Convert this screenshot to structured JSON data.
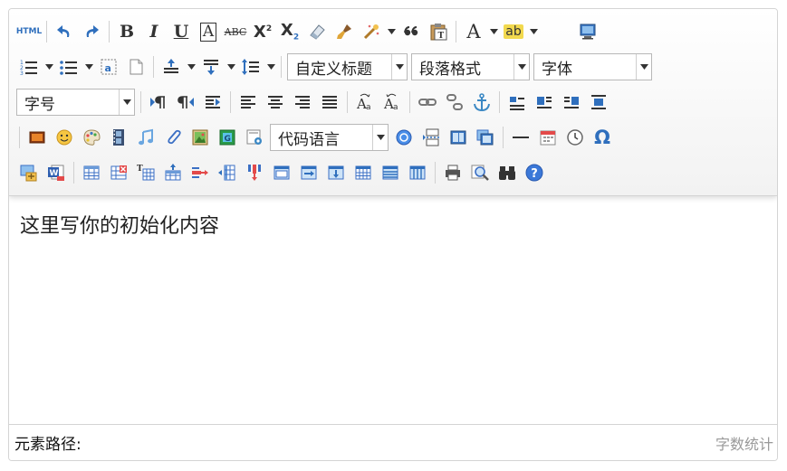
{
  "toolbar": {
    "source_label": "HTML",
    "bold": "B",
    "italic": "I",
    "underline": "U",
    "fontborder": "A",
    "strike": "ABC",
    "superscript_base": "X",
    "superscript_mark": "2",
    "subscript_base": "X",
    "subscript_mark": "2",
    "forecolor": "A",
    "backcolor": "ab",
    "custom_style": "自定义标题",
    "paragraph": "段落格式",
    "font_family": "字体",
    "font_size": "字号",
    "code_language": "代码语言",
    "omega": "Ω"
  },
  "content": {
    "initial_text": "这里写你的初始化内容"
  },
  "statusbar": {
    "path_label": "元素路径:",
    "word_count": "字数统计"
  },
  "colors": {
    "icon_blue": "#2f6fbd",
    "icon_dark": "#333333",
    "border": "#d4d4d4"
  }
}
